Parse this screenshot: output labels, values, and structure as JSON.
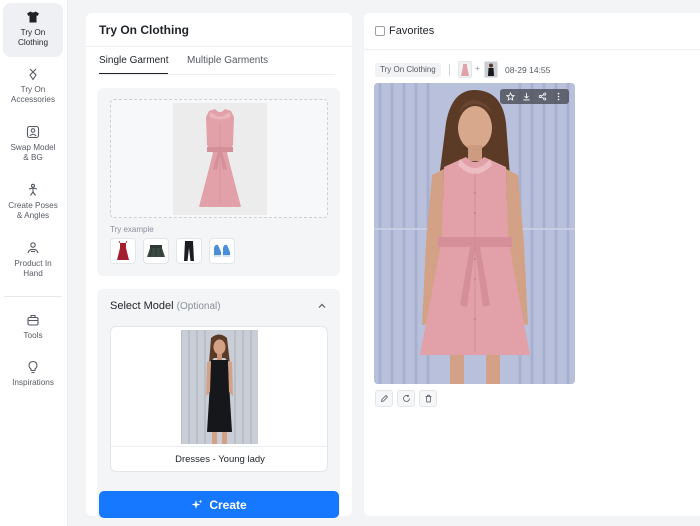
{
  "sidebar": {
    "items": [
      {
        "label": "Try On\nClothing",
        "icon": "shirt-icon",
        "active": true
      },
      {
        "label": "Try On\nAccessories",
        "icon": "accessory-icon",
        "active": false
      },
      {
        "label": "Swap Model\n& BG",
        "icon": "swap-model-icon",
        "active": false
      },
      {
        "label": "Create Poses\n& Angles",
        "icon": "pose-icon",
        "active": false
      },
      {
        "label": "Product In\nHand",
        "icon": "hand-product-icon",
        "active": false
      },
      {
        "label": "Tools",
        "icon": "tools-icon",
        "active": false
      },
      {
        "label": "Inspirations",
        "icon": "bulb-icon",
        "active": false
      }
    ]
  },
  "left_panel": {
    "title": "Try On Clothing",
    "tabs": [
      {
        "label": "Single Garment",
        "active": true
      },
      {
        "label": "Multiple Garments",
        "active": false
      }
    ],
    "try_example_label": "Try example",
    "examples": [
      "red-dress",
      "green-skirt",
      "black-pants",
      "blue-sneakers"
    ],
    "select_model": {
      "title": "Select Model",
      "optional": "(Optional)",
      "model_caption": "Dresses - Young lady"
    },
    "create_label": "Create"
  },
  "right_panel": {
    "favorites_label": "Favorites",
    "tag_label": "Try On Clothing",
    "plus": "+",
    "timestamp": "08-29 14:55"
  },
  "colors": {
    "accent": "#1677ff",
    "dress_pink": "#e2a0a8",
    "result_bg": "#b8c0dc"
  }
}
